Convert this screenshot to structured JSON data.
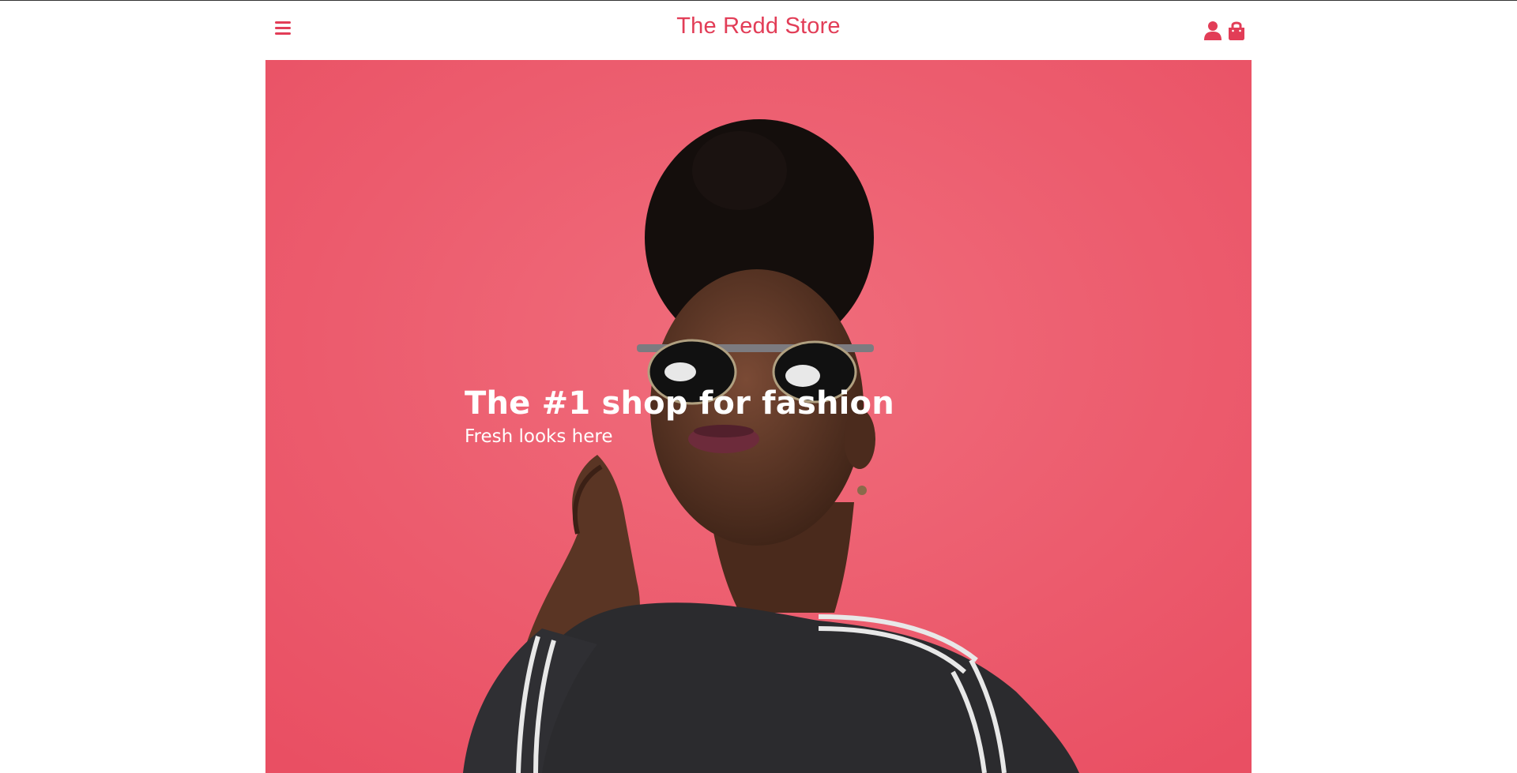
{
  "theme": {
    "accent": "#e23d57",
    "hero_background": "#ee5b6d"
  },
  "header": {
    "store_name": "The Redd Store",
    "menu_icon": "hamburger-menu-icon",
    "account_icon": "user-icon",
    "cart_icon": "shopping-bag-icon"
  },
  "hero": {
    "headline": "The #1 shop for fashion",
    "subheadline": "Fresh looks here"
  }
}
